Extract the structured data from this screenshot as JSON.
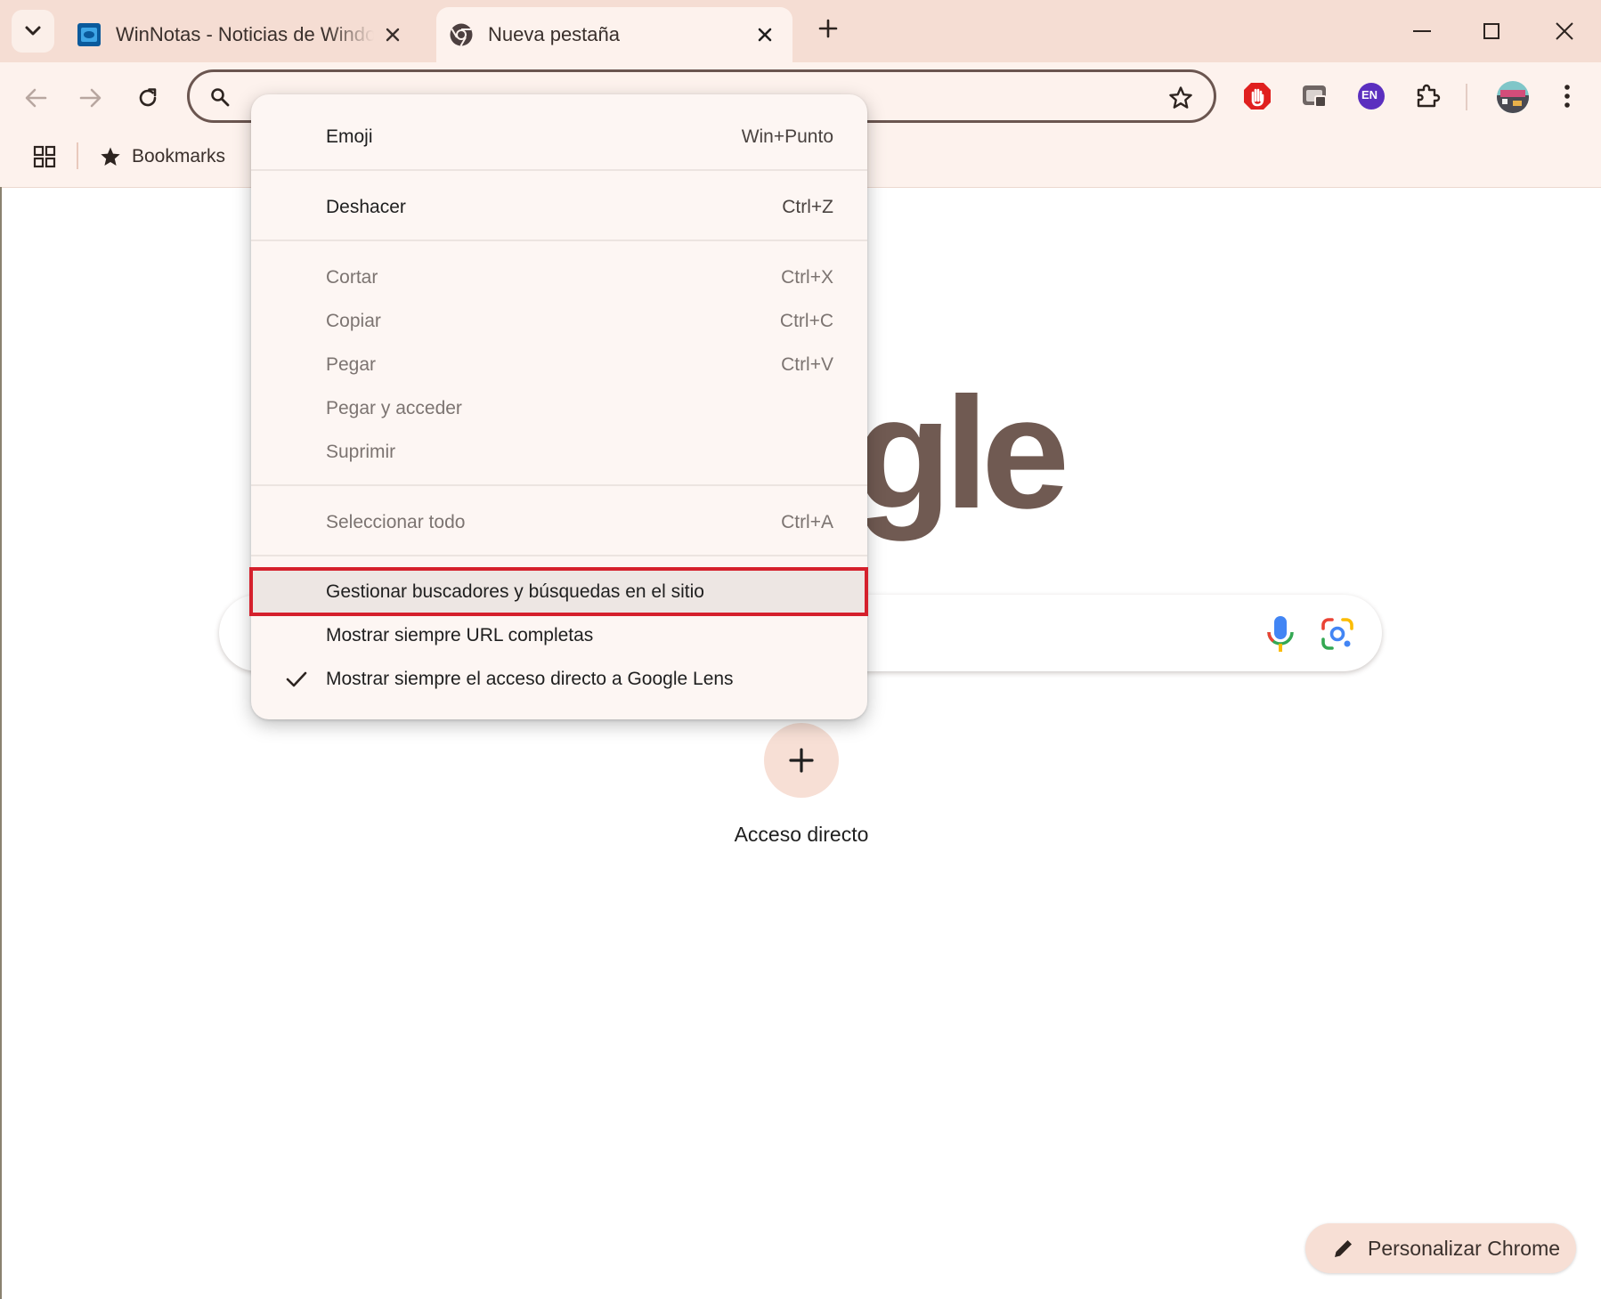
{
  "tabs": [
    {
      "title": "WinNotas - Noticias de Windows",
      "favicon": "winnotas-favicon"
    },
    {
      "title": "Nueva pestaña",
      "favicon": "chrome-icon",
      "active": true
    }
  ],
  "toolbar": {
    "omnibox_value": "",
    "extensions": [
      "adblock-icon",
      "window-capture-icon",
      "language-en-icon",
      "extensions-puzzle-icon",
      "profile-avatar"
    ],
    "language_badge": "EN"
  },
  "bookmarks_bar": {
    "items": [
      {
        "label": "Bookmarks",
        "icon": "star-icon"
      }
    ]
  },
  "page": {
    "logo_fragment": "gle",
    "shortcut_label": "Acceso directo",
    "customize_label": "Personalizar Chrome"
  },
  "context_menu": {
    "items": [
      {
        "label": "Emoji",
        "shortcut": "Win+Punto"
      },
      {
        "label": "Deshacer",
        "shortcut": "Ctrl+Z"
      },
      {
        "label": "Cortar",
        "shortcut": "Ctrl+X",
        "disabled": true
      },
      {
        "label": "Copiar",
        "shortcut": "Ctrl+C",
        "disabled": true
      },
      {
        "label": "Pegar",
        "shortcut": "Ctrl+V",
        "disabled": true
      },
      {
        "label": "Pegar y acceder",
        "shortcut": "",
        "disabled": true
      },
      {
        "label": "Suprimir",
        "shortcut": "",
        "disabled": true
      },
      {
        "label": "Seleccionar todo",
        "shortcut": "Ctrl+A",
        "disabled": true
      },
      {
        "label": "Gestionar buscadores y búsquedas en el sitio",
        "shortcut": "",
        "highlighted": true
      },
      {
        "label": "Mostrar siempre URL completas",
        "shortcut": ""
      },
      {
        "label": "Mostrar siempre el acceso directo a Google Lens",
        "shortcut": "",
        "checked": true
      }
    ]
  },
  "colors": {
    "title_bar": "#f5ddd3",
    "toolbar": "#fdf2ed",
    "logo": "#705a52",
    "highlight_border": "#d5202c"
  }
}
